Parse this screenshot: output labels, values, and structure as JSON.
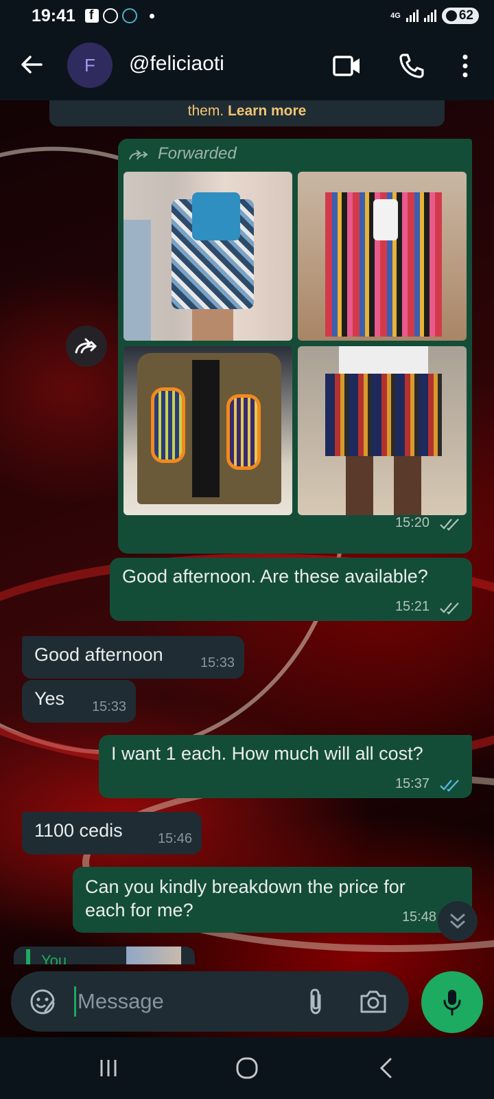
{
  "status_bar": {
    "time": "19:41",
    "network": "4G",
    "battery": "62"
  },
  "header": {
    "avatar_letter": "F",
    "contact_name": "@feliciaoti"
  },
  "notice": {
    "text": "them. ",
    "link": "Learn more"
  },
  "messages": [
    {
      "direction": "outgoing",
      "type": "forwarded-album",
      "label": "Forwarded",
      "time": "15:20",
      "status": "delivered"
    },
    {
      "direction": "outgoing",
      "text": "Good afternoon. Are these available?",
      "time": "15:21",
      "status": "delivered"
    },
    {
      "direction": "incoming",
      "text": "Good afternoon",
      "time": "15:33"
    },
    {
      "direction": "incoming",
      "text": "Yes",
      "time": "15:33"
    },
    {
      "direction": "outgoing",
      "text": "I want 1 each. How much will all cost?",
      "time": "15:37",
      "status": "read"
    },
    {
      "direction": "incoming",
      "text": "1100 cedis",
      "time": "15:46"
    },
    {
      "direction": "outgoing",
      "text": "Can you kindly breakdown the price for each for me?",
      "time": "15:48"
    },
    {
      "direction": "incoming",
      "type": "reply-preview",
      "text": "You"
    }
  ],
  "composer": {
    "placeholder": "Message"
  },
  "colors": {
    "outgoing_bubble": "#144d37",
    "incoming_bubble": "#1f2c33",
    "accent": "#1daa61",
    "read_ticks": "#53bdeb"
  }
}
